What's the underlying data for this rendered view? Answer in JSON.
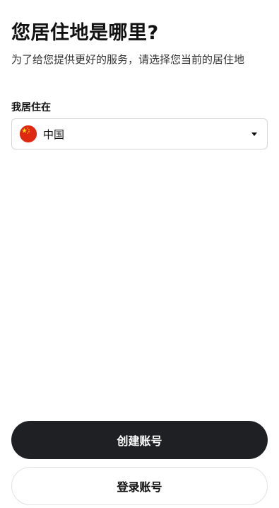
{
  "header": {
    "title": "您居住地是哪里?",
    "subtitle": "为了给您提供更好的服务，请选择您当前的居住地"
  },
  "residence": {
    "label": "我居住在",
    "selected_value": "中国",
    "flag_icon": "china-flag-icon",
    "dropdown_icon": "caret-down-icon"
  },
  "actions": {
    "create_account": "创建账号",
    "login": "登录账号"
  },
  "colors": {
    "primary_button": "#1f2024",
    "flag_red": "#de2910",
    "flag_yellow": "#ffde00"
  }
}
